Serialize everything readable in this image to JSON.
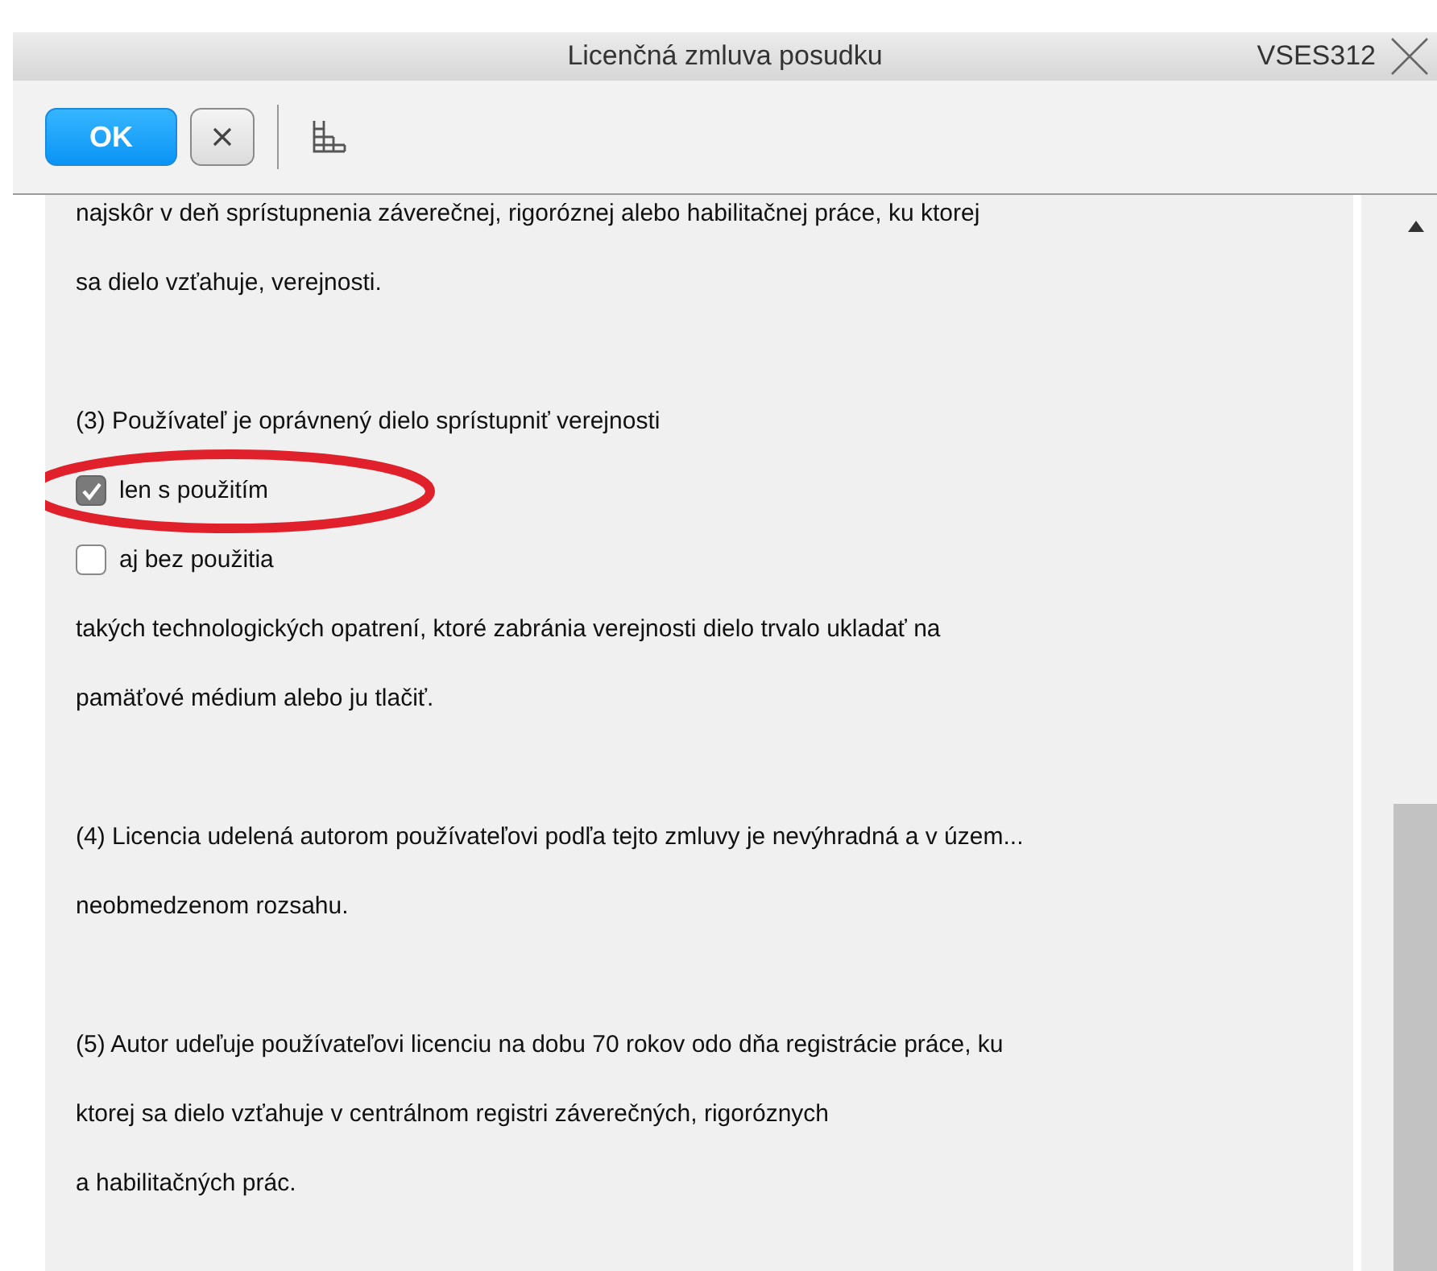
{
  "window": {
    "title": "Licenčná zmluva posudku",
    "code": "VSES312"
  },
  "toolbar": {
    "ok_label": "OK"
  },
  "blocks": [
    {
      "kind": "text",
      "lines": [
        "najskôr v deň sprístupnenia záverečnej, rigoróznej alebo habilitačnej práce, ku ktorej",
        "sa dielo vzťahuje, verejnosti."
      ]
    },
    {
      "kind": "text",
      "lines": [
        "(3) Používateľ je oprávnený dielo sprístupniť verejnosti"
      ]
    },
    {
      "kind": "checkbox",
      "label": "len s použitím",
      "checked": true,
      "highlighted": true
    },
    {
      "kind": "checkbox",
      "label": "aj bez použitia",
      "checked": false,
      "highlighted": false
    },
    {
      "kind": "text",
      "lines": [
        "takých technologických opatrení, ktoré zabránia verejnosti dielo trvalo ukladať na",
        "pamäťové médium alebo ju tlačiť."
      ]
    },
    {
      "kind": "text",
      "lines": [
        "(4) Licencia udelená autorom používateľovi podľa tejto zmluvy je nevýhradná a v územ...",
        "neobmedzenom rozsahu."
      ]
    },
    {
      "kind": "text",
      "lines": [
        "(5) Autor udeľuje používateľovi licenciu na dobu 70 rokov odo dňa registrácie práce, ku",
        "ktorej sa dielo vzťahuje v centrálnom registri záverečných, rigoróznych",
        "a habilitačných prác."
      ]
    }
  ]
}
